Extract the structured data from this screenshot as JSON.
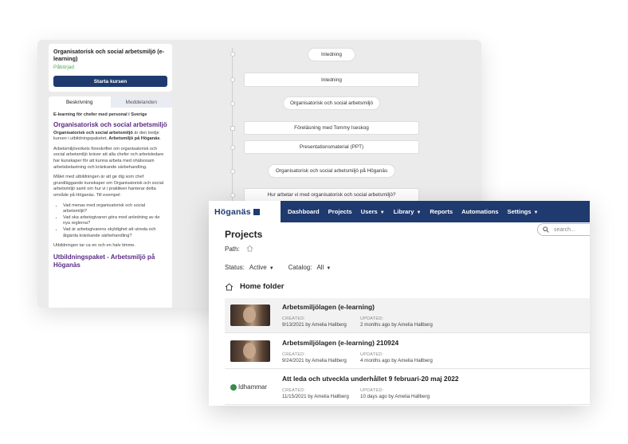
{
  "course_player": {
    "course_title": "Organisatorisk och social arbetsmiljö (e-learning)",
    "status": "Påbörjad",
    "start_button": "Starta kursen",
    "tabs": [
      "Beskrivning",
      "Meddelanden"
    ],
    "description": {
      "subtitle": "E-learning för chefer med personal i Sverige",
      "heading": "Organisatorisk och social arbetsmiljö",
      "intro_bold1": "Organisatorisk och social arbetsmiljö",
      "intro_mid": " är den tredje kursen i utbildningspaketet, ",
      "intro_bold2": "Arbetsmiljö på Höganäs",
      "intro_end": ".",
      "para2": "Arbetsmiljöverkets föreskrifter om organisatorisk och social arbetsmiljö kräver att alla chefer och arbetsledare har kunskaper för att kunna arbeta med ohälsosam arbetsbelastning och kränkande särbehandling.",
      "para3": "Målet med utbildningen är att ge dig som chef grundläggande kunskaper om Organisatorisk och social arbetsmiljö samt om hur vi i praktiken hanterar detta område på Höganäs. Till exempel:",
      "bullets": [
        "Vad menas med organisatorisk och social arbetsmiljö?",
        "Vad ska arbetsgivaren göra med anledning av de nya reglerna?",
        "Vad är arbetsgivarens skyldighet att utreda och åtgärda kränkande särbehandling?"
      ],
      "para4": "Utbildningen tar ca en och en halv timme.",
      "heading2": "Utbildningspaket - Arbetsmiljö på Höganäs"
    },
    "timeline": [
      "Inledning",
      "Inledning",
      "Organisatorisk och social arbetsmiljö",
      "Föreläsning med Tommy Iseskog",
      "Presentationsmaterial (PPT)",
      "Organisatorisk och social arbetsmiljö på Höganäs",
      "Hur arbetar vi med organisatorisk och social arbetsmiljö?"
    ]
  },
  "app": {
    "logo": "Höganäs",
    "nav": [
      {
        "label": "Dashboard"
      },
      {
        "label": "Projects"
      },
      {
        "label": "Users",
        "dropdown": true
      },
      {
        "label": "Library",
        "dropdown": true
      },
      {
        "label": "Reports"
      },
      {
        "label": "Automations"
      },
      {
        "label": "Settings",
        "dropdown": true
      }
    ],
    "page_title": "Projects",
    "search_placeholder": "search...",
    "path_label": "Path:",
    "status_label": "Status:",
    "status_value": "Active",
    "catalog_label": "Catalog:",
    "catalog_value": "All",
    "folder_title": "Home folder",
    "created_label": "CREATED:",
    "updated_label": "UPDATED:",
    "projects": [
      {
        "name": "Arbetsmiljölagen (e-learning)",
        "created": "9/13/2021 by Amelia Hallberg",
        "updated": "2 months ago by Amelia Hallberg",
        "thumb": "photo"
      },
      {
        "name": "Arbetsmiljölagen (e-learning) 210924",
        "created": "9/24/2021 by Amelia Hallberg",
        "updated": "4 months ago by Amelia Hallberg",
        "thumb": "photo"
      },
      {
        "name": "Att leda och utveckla underhållet 9 februari-20 maj 2022",
        "created": "11/15/2021 by Amelia Hallberg",
        "updated": "10 days ago by Amelia Hallberg",
        "thumb": "logo",
        "thumb_text": "Idhammar"
      }
    ]
  },
  "colors": {
    "brand_navy": "#1f3a6e",
    "accent_purple": "#5b2a86",
    "status_green": "#4caa52"
  }
}
